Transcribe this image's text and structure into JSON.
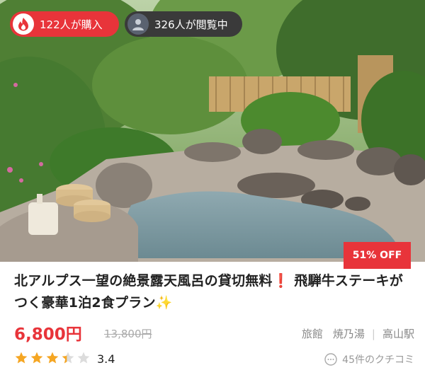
{
  "badges": {
    "buyers": "122人が購入",
    "viewers": "326人が閲覧中"
  },
  "discount": "51% OFF",
  "title": {
    "part1": "北アルプス一望の絶景露天風呂の貸切無料",
    "exclaim": "❗",
    "part2": " 飛騨牛ステーキがつく豪華1泊2食プラン",
    "sparkle": "✨"
  },
  "price": {
    "current": "6,800円",
    "original": "13,800円"
  },
  "location": {
    "type": "旅館",
    "name": "焼乃湯",
    "station": "高山駅"
  },
  "rating": {
    "value": "3.4",
    "stars": 3.4
  },
  "reviews": "45件のクチコミ",
  "colors": {
    "accent": "#e8343a",
    "star": "#f5a623"
  },
  "icons": {
    "buyers": "fire-icon",
    "viewers": "user-avatar-icon",
    "reviews": "speech-bubble-icon"
  }
}
